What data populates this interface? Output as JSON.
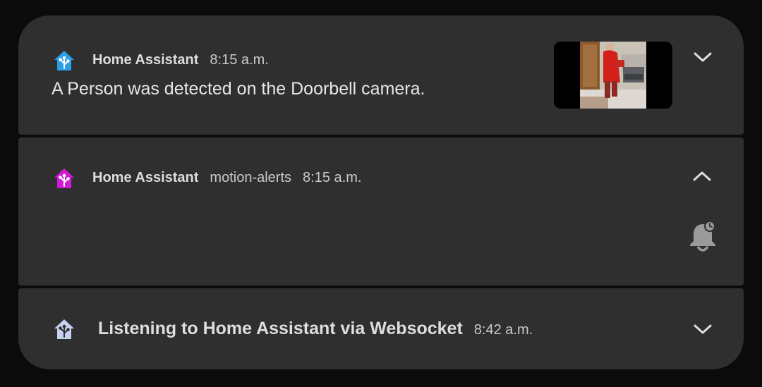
{
  "colors": {
    "card_bg": "#2f2f2f",
    "icon_blue": "#2a9fe6",
    "icon_magenta": "#d01ad6",
    "icon_light": "#c7d0f0"
  },
  "notifications": [
    {
      "app_name": "Home Assistant",
      "time": "8:15 a.m.",
      "message": "A Person was detected on the Doorbell camera.",
      "icon": "home-assistant-icon",
      "expand_icon": "chevron-down-icon",
      "has_thumbnail": true
    },
    {
      "app_name": "Home Assistant",
      "channel": "motion-alerts",
      "time": "8:15 a.m.",
      "icon": "home-assistant-icon",
      "expand_icon": "chevron-up-icon",
      "action_icon": "snooze-bell-icon"
    },
    {
      "title": "Listening to Home Assistant via Websocket",
      "time": "8:42 a.m.",
      "icon": "home-assistant-icon",
      "expand_icon": "chevron-down-icon"
    }
  ]
}
